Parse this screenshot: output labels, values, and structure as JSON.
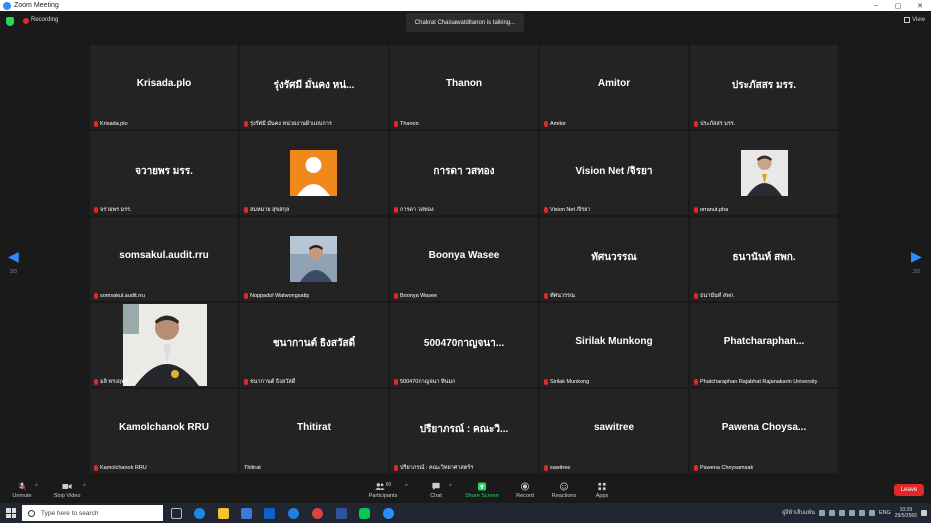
{
  "window": {
    "title": "Zoom Meeting",
    "controls": [
      "–",
      "▢",
      "✕"
    ]
  },
  "topbar": {
    "recording_label": "Recording",
    "talking": "Chakrat Chaisawatditanon is talking...",
    "view_label": "View"
  },
  "colors": {
    "accent": "#2d8cff",
    "danger": "#e02828",
    "tile_bg": "#232323",
    "bg": "#1a1a1a",
    "green": "#23d959"
  },
  "pagination": {
    "left": "3/3",
    "right": "3/3"
  },
  "tiles": [
    {
      "big": "Krisada.plo",
      "label": "Krisada.plo"
    },
    {
      "big": "รุ่งรัศมี มั่นคง หน่...",
      "label": "รุ่งรัศมี มั่นคง หน่วยงานฝ้าแถบการ"
    },
    {
      "big": "Thanon",
      "label": "Thanon"
    },
    {
      "big": "Amitor",
      "label": "Amitor"
    },
    {
      "big": "ประภัสสร มรร.",
      "label": "ประภัสสร มรร."
    },
    {
      "big": "จวายพร มรร.",
      "label": "จรายพร มรร."
    },
    {
      "big": "",
      "label": "สมหมาย สุขสกุล"
    },
    {
      "big": "การดา วสทอง",
      "label": "การดา วสทอง"
    },
    {
      "big": "Vision Net /จิรยา",
      "label": "Vision Net /จิรยา"
    },
    {
      "big": "",
      "label": "orranut.pha"
    },
    {
      "big": "somsakul.audit.rru",
      "label": "somsakul.audit.rru"
    },
    {
      "big": "",
      "label": "Noppadol Watwongsatip"
    },
    {
      "big": "Boonya Wasee",
      "label": "Boonya Wasee"
    },
    {
      "big": "ทัศนวรรณ",
      "label": "ทัศนวรรณ"
    },
    {
      "big": "ธนานันท์ สพก.",
      "label": "ธนานันท์ สพก."
    },
    {
      "big": "",
      "label": "มลิ ทรงฤทธิ์"
    },
    {
      "big": "ชนากานต์ ธิงสวัสดิ์",
      "label": "ชนากานต์ ธิงสวัสดิ์"
    },
    {
      "big": "500470กาญจนา...",
      "label": "500470กาญจนา ทิ่นมก"
    },
    {
      "big": "Sirilak Munkong",
      "label": "Sirilak Munkong"
    },
    {
      "big": "Phatcharaphan...",
      "label": "Phatcharaphan Rajabhat Rajanakarin University"
    },
    {
      "big": "Kamolchanok RRU",
      "label": "Kamolchanok RRU"
    },
    {
      "big": "Thitirat",
      "label": "Thitirat"
    },
    {
      "big": "ปรียาภรณ์ : คณะวิ...",
      "label": "ปรียาภรณ์ : คณะวิทยาศาสตร์ฯ"
    },
    {
      "big": "sawitree",
      "label": "sawitree"
    },
    {
      "big": "Pawena Choysa...",
      "label": "Pawena Choysamsak"
    }
  ],
  "toolbar": {
    "unmute": "Unmute",
    "stop_video": "Stop Video",
    "participants": "Participants",
    "participants_count": "60",
    "chat": "Chat",
    "share_screen": "Share Screen",
    "record": "Record",
    "reactions": "Reactions",
    "apps": "Apps",
    "leave": "Leave"
  },
  "taskbar": {
    "search_placeholder": "Type here to search",
    "weather": "ฝูงีฟ้าเล็บแพ้น",
    "lang": "ENG",
    "time": "10:39",
    "date": "29/5/2566"
  }
}
